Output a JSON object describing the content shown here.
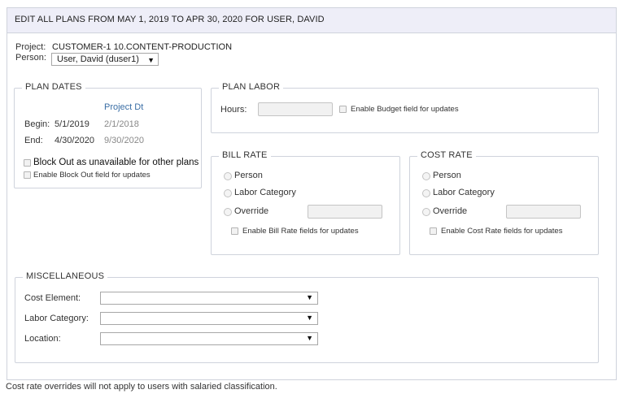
{
  "header": {
    "title": "EDIT ALL PLANS FROM MAY 1, 2019 TO APR 30, 2020 FOR USER, DAVID"
  },
  "info": {
    "project_label": "Project:",
    "project_value": "CUSTOMER-1 10.CONTENT-PRODUCTION",
    "person_label": "Person:",
    "person_value": "User, David (duser1)"
  },
  "plan_dates": {
    "legend": "PLAN DATES",
    "project_dt_header": "Project Dt",
    "begin_label": "Begin:",
    "begin_value": "5/1/2019",
    "begin_project": "2/1/2018",
    "end_label": "End:",
    "end_value": "4/30/2020",
    "end_project": "9/30/2020",
    "block_out_label": "Block Out as unavailable for other plans",
    "enable_block_out_label": "Enable Block Out field for updates"
  },
  "plan_labor": {
    "legend": "PLAN LABOR",
    "hours_label": "Hours:",
    "hours_value": "",
    "enable_budget_label": "Enable Budget field for updates"
  },
  "bill_rate": {
    "legend": "BILL RATE",
    "options": [
      "Person",
      "Labor Category",
      "Override"
    ],
    "override_value": "",
    "enable_label": "Enable Bill Rate fields for updates"
  },
  "cost_rate": {
    "legend": "COST RATE",
    "options": [
      "Person",
      "Labor Category",
      "Override"
    ],
    "override_value": "",
    "enable_label": "Enable Cost Rate fields for updates"
  },
  "misc": {
    "legend": "MISCELLANEOUS",
    "cost_element_label": "Cost Element:",
    "cost_element_value": "",
    "labor_category_label": "Labor Category:",
    "labor_category_value": "",
    "location_label": "Location:",
    "location_value": ""
  },
  "footer": {
    "note": "Cost rate overrides will not apply to users with salaried classification."
  }
}
